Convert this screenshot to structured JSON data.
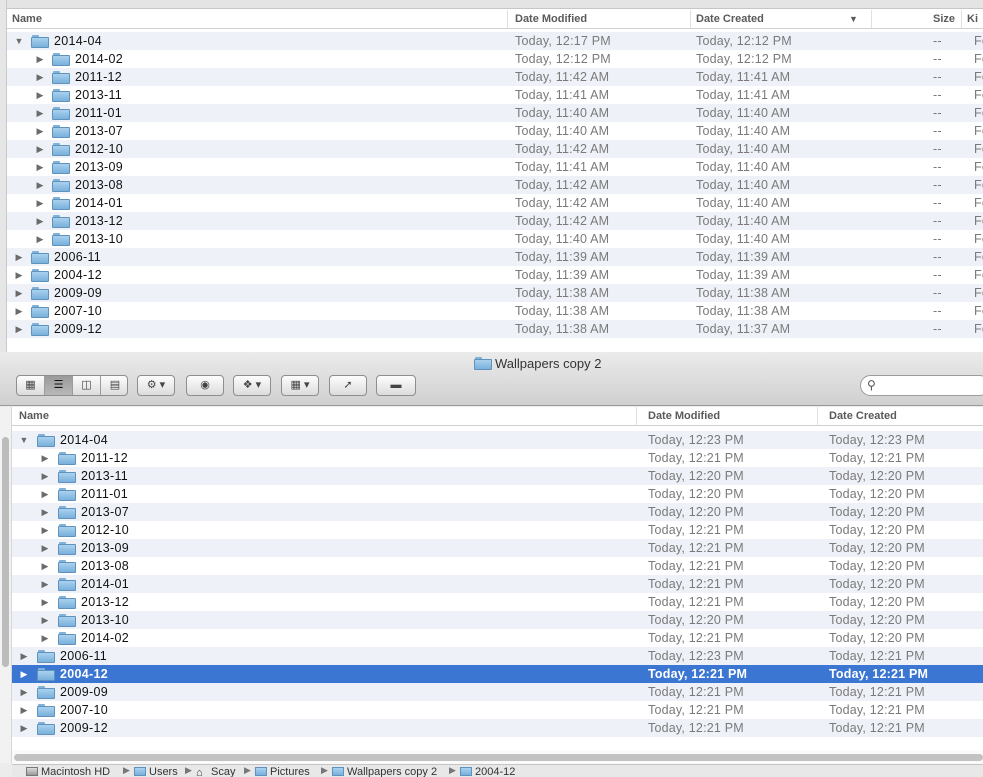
{
  "top_window": {
    "columns": {
      "name": "Name",
      "date_modified": "Date Modified",
      "date_created": "Date Created",
      "size": "Size",
      "kind": "Ki"
    },
    "sort_indicator": "▼",
    "rows": [
      {
        "level": 0,
        "expanded": true,
        "name": "2014-04",
        "modified": "Today, 12:17 PM",
        "created": "Today, 12:12 PM",
        "size": "--",
        "kind": "Fo"
      },
      {
        "level": 1,
        "expanded": false,
        "name": "2014-02",
        "modified": "Today, 12:12 PM",
        "created": "Today, 12:12 PM",
        "size": "--",
        "kind": "Fo"
      },
      {
        "level": 1,
        "expanded": false,
        "name": "2011-12",
        "modified": "Today, 11:42 AM",
        "created": "Today, 11:41 AM",
        "size": "--",
        "kind": "Fo"
      },
      {
        "level": 1,
        "expanded": false,
        "name": "2013-11",
        "modified": "Today, 11:41 AM",
        "created": "Today, 11:41 AM",
        "size": "--",
        "kind": "Fo"
      },
      {
        "level": 1,
        "expanded": false,
        "name": "2011-01",
        "modified": "Today, 11:40 AM",
        "created": "Today, 11:40 AM",
        "size": "--",
        "kind": "Fo"
      },
      {
        "level": 1,
        "expanded": false,
        "name": "2013-07",
        "modified": "Today, 11:40 AM",
        "created": "Today, 11:40 AM",
        "size": "--",
        "kind": "Fo"
      },
      {
        "level": 1,
        "expanded": false,
        "name": "2012-10",
        "modified": "Today, 11:42 AM",
        "created": "Today, 11:40 AM",
        "size": "--",
        "kind": "Fo"
      },
      {
        "level": 1,
        "expanded": false,
        "name": "2013-09",
        "modified": "Today, 11:41 AM",
        "created": "Today, 11:40 AM",
        "size": "--",
        "kind": "Fo"
      },
      {
        "level": 1,
        "expanded": false,
        "name": "2013-08",
        "modified": "Today, 11:42 AM",
        "created": "Today, 11:40 AM",
        "size": "--",
        "kind": "Fo"
      },
      {
        "level": 1,
        "expanded": false,
        "name": "2014-01",
        "modified": "Today, 11:42 AM",
        "created": "Today, 11:40 AM",
        "size": "--",
        "kind": "Fo"
      },
      {
        "level": 1,
        "expanded": false,
        "name": "2013-12",
        "modified": "Today, 11:42 AM",
        "created": "Today, 11:40 AM",
        "size": "--",
        "kind": "Fo"
      },
      {
        "level": 1,
        "expanded": false,
        "name": "2013-10",
        "modified": "Today, 11:40 AM",
        "created": "Today, 11:40 AM",
        "size": "--",
        "kind": "Fo"
      },
      {
        "level": 0,
        "expanded": false,
        "name": "2006-11",
        "modified": "Today, 11:39 AM",
        "created": "Today, 11:39 AM",
        "size": "--",
        "kind": "Fo"
      },
      {
        "level": 0,
        "expanded": false,
        "name": "2004-12",
        "modified": "Today, 11:39 AM",
        "created": "Today, 11:39 AM",
        "size": "--",
        "kind": "Fo"
      },
      {
        "level": 0,
        "expanded": false,
        "name": "2009-09",
        "modified": "Today, 11:38 AM",
        "created": "Today, 11:38 AM",
        "size": "--",
        "kind": "Fo"
      },
      {
        "level": 0,
        "expanded": false,
        "name": "2007-10",
        "modified": "Today, 11:38 AM",
        "created": "Today, 11:38 AM",
        "size": "--",
        "kind": "Fo"
      },
      {
        "level": 0,
        "expanded": false,
        "name": "2009-12",
        "modified": "Today, 11:38 AM",
        "created": "Today, 11:37 AM",
        "size": "--",
        "kind": "Fo"
      }
    ]
  },
  "front_window": {
    "title": "Wallpapers copy 2",
    "toolbar": {
      "view_modes": [
        "icon-view-icon",
        "list-view-icon",
        "column-view-icon",
        "coverflow-view-icon"
      ],
      "active_view": 1,
      "action_icon": "gear-icon",
      "quicklook_icon": "eye-icon",
      "dropbox_icon": "dropbox-icon",
      "arrange_icon": "arrange-icon",
      "share_icon": "share-icon",
      "tags_icon": "tags-icon",
      "search_placeholder": ""
    },
    "columns": {
      "name": "Name",
      "date_modified": "Date Modified",
      "date_created": "Date Created"
    },
    "selected_index": 13,
    "rows": [
      {
        "level": 0,
        "expanded": true,
        "name": "2014-04",
        "modified": "Today, 12:23 PM",
        "created": "Today, 12:23 PM"
      },
      {
        "level": 1,
        "expanded": false,
        "name": "2011-12",
        "modified": "Today, 12:21 PM",
        "created": "Today, 12:21 PM"
      },
      {
        "level": 1,
        "expanded": false,
        "name": "2013-11",
        "modified": "Today, 12:20 PM",
        "created": "Today, 12:20 PM"
      },
      {
        "level": 1,
        "expanded": false,
        "name": "2011-01",
        "modified": "Today, 12:20 PM",
        "created": "Today, 12:20 PM"
      },
      {
        "level": 1,
        "expanded": false,
        "name": "2013-07",
        "modified": "Today, 12:20 PM",
        "created": "Today, 12:20 PM"
      },
      {
        "level": 1,
        "expanded": false,
        "name": "2012-10",
        "modified": "Today, 12:21 PM",
        "created": "Today, 12:20 PM"
      },
      {
        "level": 1,
        "expanded": false,
        "name": "2013-09",
        "modified": "Today, 12:21 PM",
        "created": "Today, 12:20 PM"
      },
      {
        "level": 1,
        "expanded": false,
        "name": "2013-08",
        "modified": "Today, 12:21 PM",
        "created": "Today, 12:20 PM"
      },
      {
        "level": 1,
        "expanded": false,
        "name": "2014-01",
        "modified": "Today, 12:21 PM",
        "created": "Today, 12:20 PM"
      },
      {
        "level": 1,
        "expanded": false,
        "name": "2013-12",
        "modified": "Today, 12:21 PM",
        "created": "Today, 12:20 PM"
      },
      {
        "level": 1,
        "expanded": false,
        "name": "2013-10",
        "modified": "Today, 12:20 PM",
        "created": "Today, 12:20 PM"
      },
      {
        "level": 1,
        "expanded": false,
        "name": "2014-02",
        "modified": "Today, 12:21 PM",
        "created": "Today, 12:20 PM"
      },
      {
        "level": 0,
        "expanded": false,
        "name": "2006-11",
        "modified": "Today, 12:23 PM",
        "created": "Today, 12:21 PM"
      },
      {
        "level": 0,
        "expanded": false,
        "name": "2004-12",
        "modified": "Today, 12:21 PM",
        "created": "Today, 12:21 PM"
      },
      {
        "level": 0,
        "expanded": false,
        "name": "2009-09",
        "modified": "Today, 12:21 PM",
        "created": "Today, 12:21 PM"
      },
      {
        "level": 0,
        "expanded": false,
        "name": "2007-10",
        "modified": "Today, 12:21 PM",
        "created": "Today, 12:21 PM"
      },
      {
        "level": 0,
        "expanded": false,
        "name": "2009-12",
        "modified": "Today, 12:21 PM",
        "created": "Today, 12:21 PM"
      }
    ],
    "path_bar": [
      "Macintosh HD",
      "Users",
      "Scay",
      "Pictures",
      "Wallpapers copy 2",
      "2004-12"
    ]
  },
  "colors": {
    "selection": "#3b76d2",
    "alt_row": "#eef2f8",
    "folder": "#79b0da"
  }
}
